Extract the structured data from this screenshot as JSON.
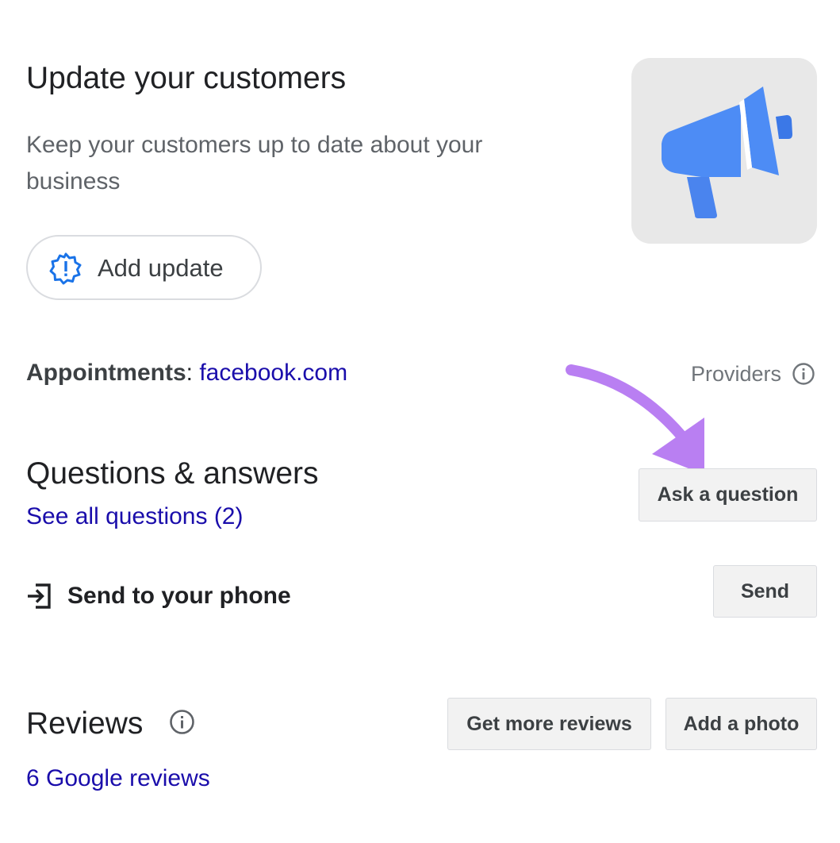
{
  "update": {
    "title": "Update your customers",
    "description": "Keep your customers up to date about your business",
    "add_update_label": "Add update",
    "icon": "megaphone-icon",
    "accent": "#4285f4"
  },
  "appointments": {
    "label": "Appointments",
    "separator": ": ",
    "link": "facebook.com",
    "providers_label": "Providers"
  },
  "qa": {
    "title": "Questions & answers",
    "see_all_label": "See all questions (2)",
    "ask_label": "Ask a question"
  },
  "send": {
    "label": "Send to your phone",
    "button_label": "Send"
  },
  "reviews": {
    "title": "Reviews",
    "link_label": "6 Google reviews",
    "get_more_label": "Get more reviews",
    "add_photo_label": "Add a photo"
  },
  "colors": {
    "link": "#1a0dab",
    "annotation_arrow": "#b97ff2",
    "button_bg": "#f2f2f2"
  }
}
